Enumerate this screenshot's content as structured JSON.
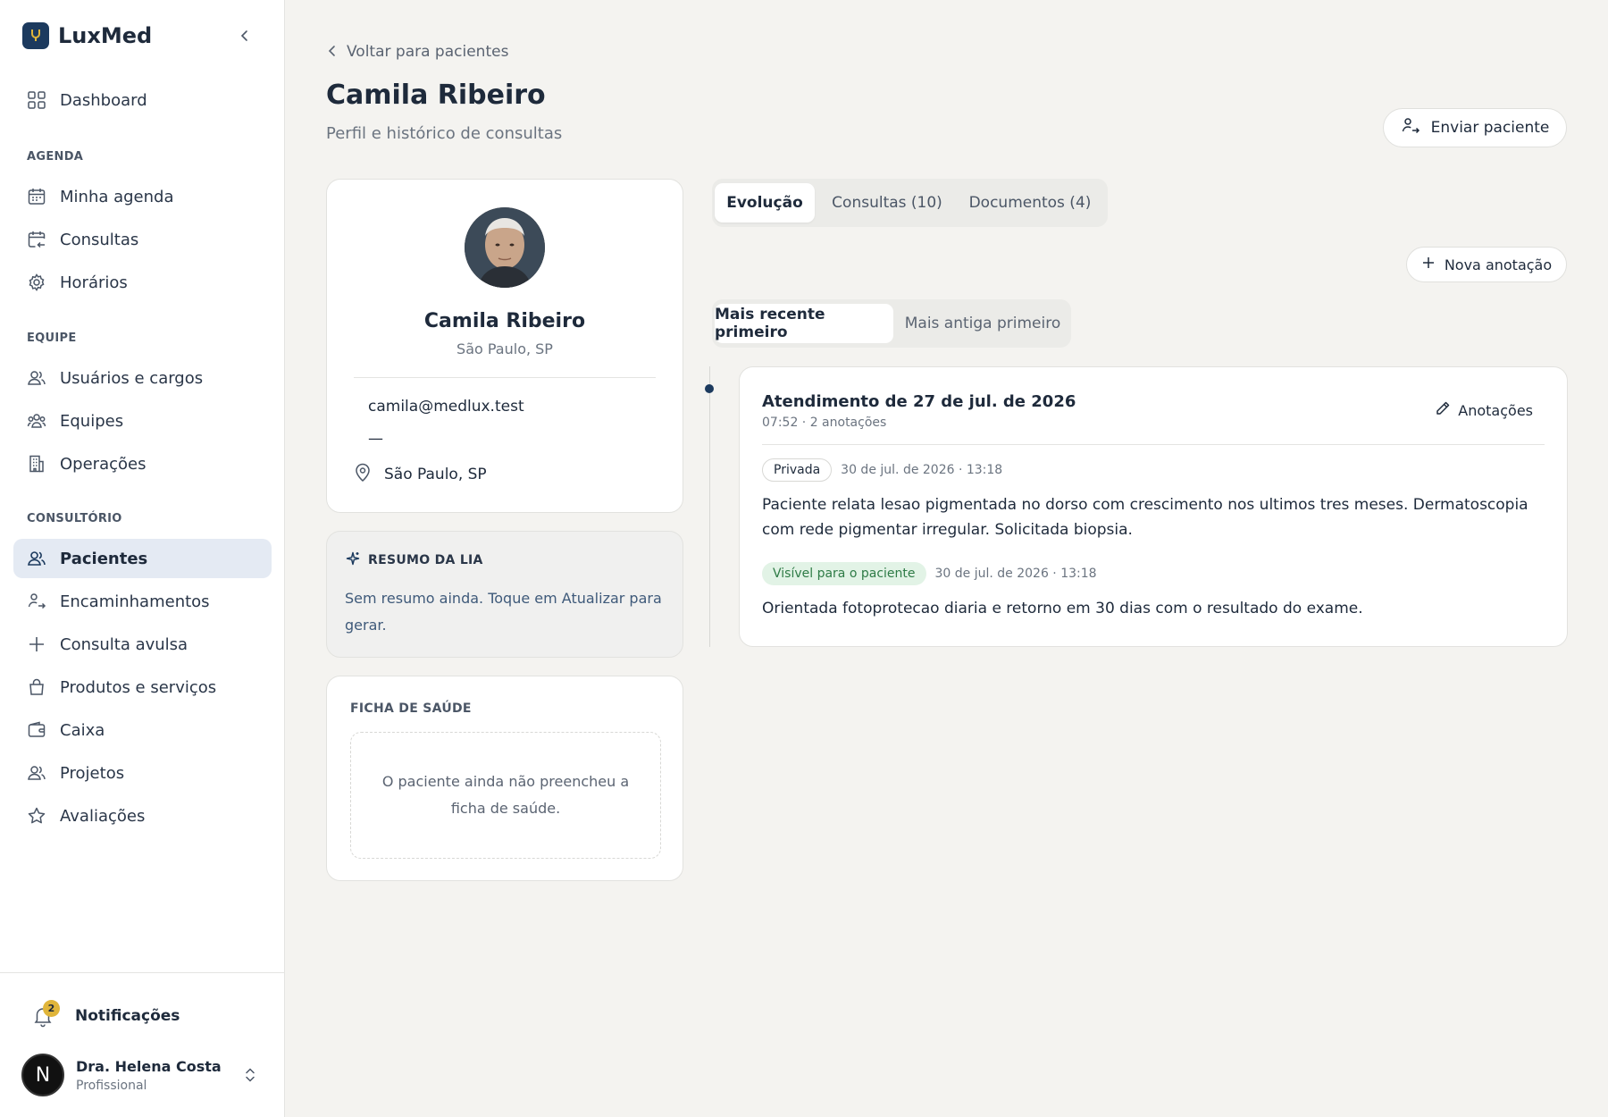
{
  "brand": {
    "name": "LuxMed",
    "logo_icon": "stethoscope-icon"
  },
  "sidebar": {
    "top_items": [
      {
        "label": "Dashboard",
        "icon": "grid-icon"
      }
    ],
    "sections": [
      {
        "label": "AGENDA",
        "items": [
          {
            "label": "Minha agenda",
            "icon": "calendar-icon"
          },
          {
            "label": "Consultas",
            "icon": "calendar-return-icon"
          },
          {
            "label": "Horários",
            "icon": "gear-icon"
          }
        ]
      },
      {
        "label": "EQUIPE",
        "items": [
          {
            "label": "Usuários e cargos",
            "icon": "users-icon"
          },
          {
            "label": "Equipes",
            "icon": "team-icon"
          },
          {
            "label": "Operações",
            "icon": "building-icon"
          }
        ]
      },
      {
        "label": "CONSULTÓRIO",
        "items": [
          {
            "label": "Pacientes",
            "icon": "users-icon",
            "active": true
          },
          {
            "label": "Encaminhamentos",
            "icon": "referral-icon"
          },
          {
            "label": "Consulta avulsa",
            "icon": "plus-icon"
          },
          {
            "label": "Produtos e serviços",
            "icon": "bag-icon"
          },
          {
            "label": "Caixa",
            "icon": "wallet-icon"
          },
          {
            "label": "Projetos",
            "icon": "projects-icon"
          },
          {
            "label": "Avaliações",
            "icon": "star-icon"
          }
        ]
      }
    ],
    "notifications": {
      "label": "Notificações",
      "count": "2"
    },
    "user": {
      "initial": "N",
      "name": "Dra. Helena Costa",
      "role": "Profissional"
    }
  },
  "header": {
    "back_label": "Voltar para pacientes",
    "title": "Camila Ribeiro",
    "subtitle": "Perfil e histórico de consultas",
    "send_button": "Enviar paciente"
  },
  "profile": {
    "name": "Camila Ribeiro",
    "location": "São Paulo, SP",
    "email": "camila@medlux.test",
    "phone": "—",
    "city": "São Paulo, SP"
  },
  "summary": {
    "title": "RESUMO DA LIA",
    "text": "Sem resumo ainda. Toque em Atualizar para gerar."
  },
  "health": {
    "title": "FICHA DE SAÚDE",
    "empty_text": "O paciente ainda não preencheu a ficha de saúde."
  },
  "tabs": [
    {
      "label": "Evolução",
      "active": true
    },
    {
      "label": "Consultas (10)",
      "active": false
    },
    {
      "label": "Documentos (4)",
      "active": false
    }
  ],
  "new_note_button": "Nova anotação",
  "sort": [
    {
      "label": "Mais recente primeiro",
      "active": true
    },
    {
      "label": "Mais antiga primeiro",
      "active": false
    }
  ],
  "entry": {
    "title": "Atendimento de 27 de jul. de 2026",
    "meta": "07:52 · 2 anotações",
    "notes_button": "Anotações",
    "notes": [
      {
        "badge": "Privada",
        "time": "30 de jul. de 2026 · 13:18",
        "text": "Paciente relata lesao pigmentada no dorso com crescimento nos ultimos tres meses. Dermatoscopia com rede pigmentar irregular. Solicitada biopsia."
      },
      {
        "badge": "Visível para o paciente",
        "time": "30 de jul. de 2026 · 13:18",
        "text": "Orientada fotoprotecao diaria e retorno em 30 dias com o resultado do exame."
      }
    ]
  },
  "colors": {
    "accent": "#1c3a5e",
    "badge": "#e0b53a",
    "active_nav_bg": "#e4eaf3",
    "visible_pill_bg": "#e2f3e6"
  }
}
